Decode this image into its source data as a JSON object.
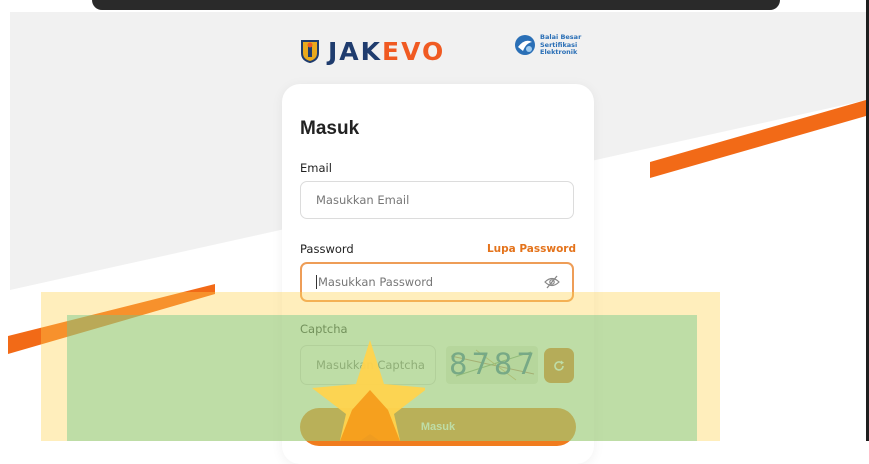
{
  "brand": {
    "jakevo_prefix": "JAK",
    "jakevo_accent": "EVO",
    "bsre_line1": "Balai Besar",
    "bsre_line2": "Sertifikasi",
    "bsre_line3": "Elektronik"
  },
  "login": {
    "title": "Masuk",
    "email_label": "Email",
    "email_placeholder": "Masukkan Email",
    "password_label": "Password",
    "forgot_password": "Lupa Password",
    "password_placeholder": "Masukkan Password",
    "captcha_label": "Captcha",
    "captcha_placeholder": "Masukkan Captcha",
    "captcha_code": "8787",
    "submit_label": "Masuk"
  },
  "colors": {
    "accent": "#f07c1e",
    "link": "#e4731b",
    "focus_border": "#ee9d57",
    "logo_blue": "#1f3c6e"
  },
  "icons": [
    "eye-slash-icon",
    "refresh-icon",
    "star-icon",
    "jakarta-emblem-icon",
    "bsre-logo-icon"
  ]
}
